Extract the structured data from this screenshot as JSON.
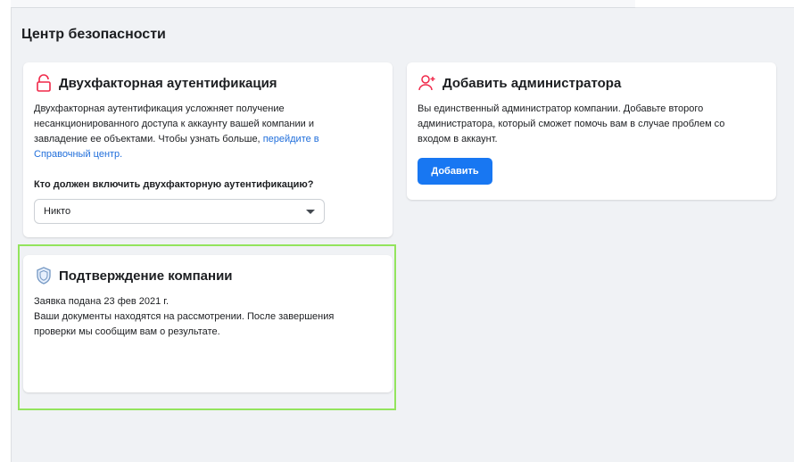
{
  "page": {
    "title": "Центр безопасности"
  },
  "two_factor": {
    "title": "Двухфакторная аутентификация",
    "description": "Двухфакторная аутентификация усложняет получение несанкционированного доступа к аккаунту вашей компании и завладение ее объектами. Чтобы узнать больше,",
    "link": "перейдите в Справочный центр.",
    "question": "Кто должен включить двухфакторную аутентификацию?",
    "select_value": "Никто",
    "icon": "lock-icon"
  },
  "add_admin": {
    "title": "Добавить администратора",
    "description": "Вы единственный администратор компании. Добавьте второго администратора, который сможет помочь вам в случае проблем со входом в аккаунт.",
    "button": "Добавить",
    "icon": "add-user-icon"
  },
  "verification": {
    "title": "Подтверждение компании",
    "line1": "Заявка подана 23 фев 2021 г.",
    "line2": "Ваши документы находятся на рассмотрении. После завершения проверки мы сообщим вам о результате.",
    "icon": "shield-icon"
  },
  "colors": {
    "accent": "#1877f2",
    "icon_red": "#f02849",
    "highlight": "#93e45d",
    "link": "#216fdb"
  }
}
